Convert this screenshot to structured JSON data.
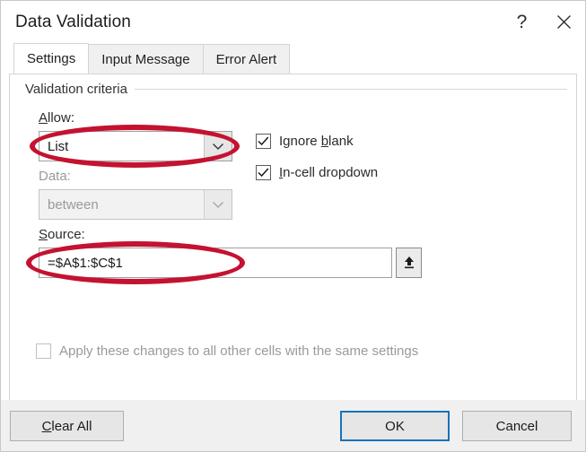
{
  "window": {
    "title": "Data Validation",
    "help_icon": "question-mark-icon",
    "close_icon": "close-x-icon"
  },
  "tabs": [
    {
      "label": "Settings",
      "active": true
    },
    {
      "label": "Input Message",
      "active": false
    },
    {
      "label": "Error Alert",
      "active": false
    }
  ],
  "settings": {
    "group_title": "Validation criteria",
    "allow": {
      "label_prefix": "",
      "label_accel": "A",
      "label_suffix": "llow:",
      "value": "List",
      "dropdown_icon": "chevron-down-icon",
      "annotated": true
    },
    "data": {
      "label": "Data:",
      "value": "between",
      "dropdown_icon": "chevron-down-icon",
      "disabled": true
    },
    "source": {
      "label_accel": "S",
      "label_suffix": "ource:",
      "value": "=$A$1:$C$1",
      "picker_icon": "collapse-range-up-arrow-icon",
      "annotated": true
    },
    "ignore_blank": {
      "label_prefix": "Ignore ",
      "label_accel": "b",
      "label_suffix": "lank",
      "checked": true,
      "check_icon": "checkmark-icon"
    },
    "in_cell_dropdown": {
      "label_prefix": "",
      "label_accel": "I",
      "label_suffix": "n-cell dropdown",
      "checked": true,
      "check_icon": "checkmark-icon"
    },
    "apply_all": {
      "label": "Apply these changes to all other cells with the same settings",
      "checked": false,
      "disabled": true
    }
  },
  "footer": {
    "clear_all": {
      "accel": "C",
      "suffix": "lear All"
    },
    "ok": "OK",
    "cancel": "Cancel"
  },
  "colors": {
    "annotation_red": "#c41230",
    "focus_blue": "#1a72b8",
    "dialog_bg": "#ffffff",
    "footer_bg": "#f0f0f0"
  }
}
